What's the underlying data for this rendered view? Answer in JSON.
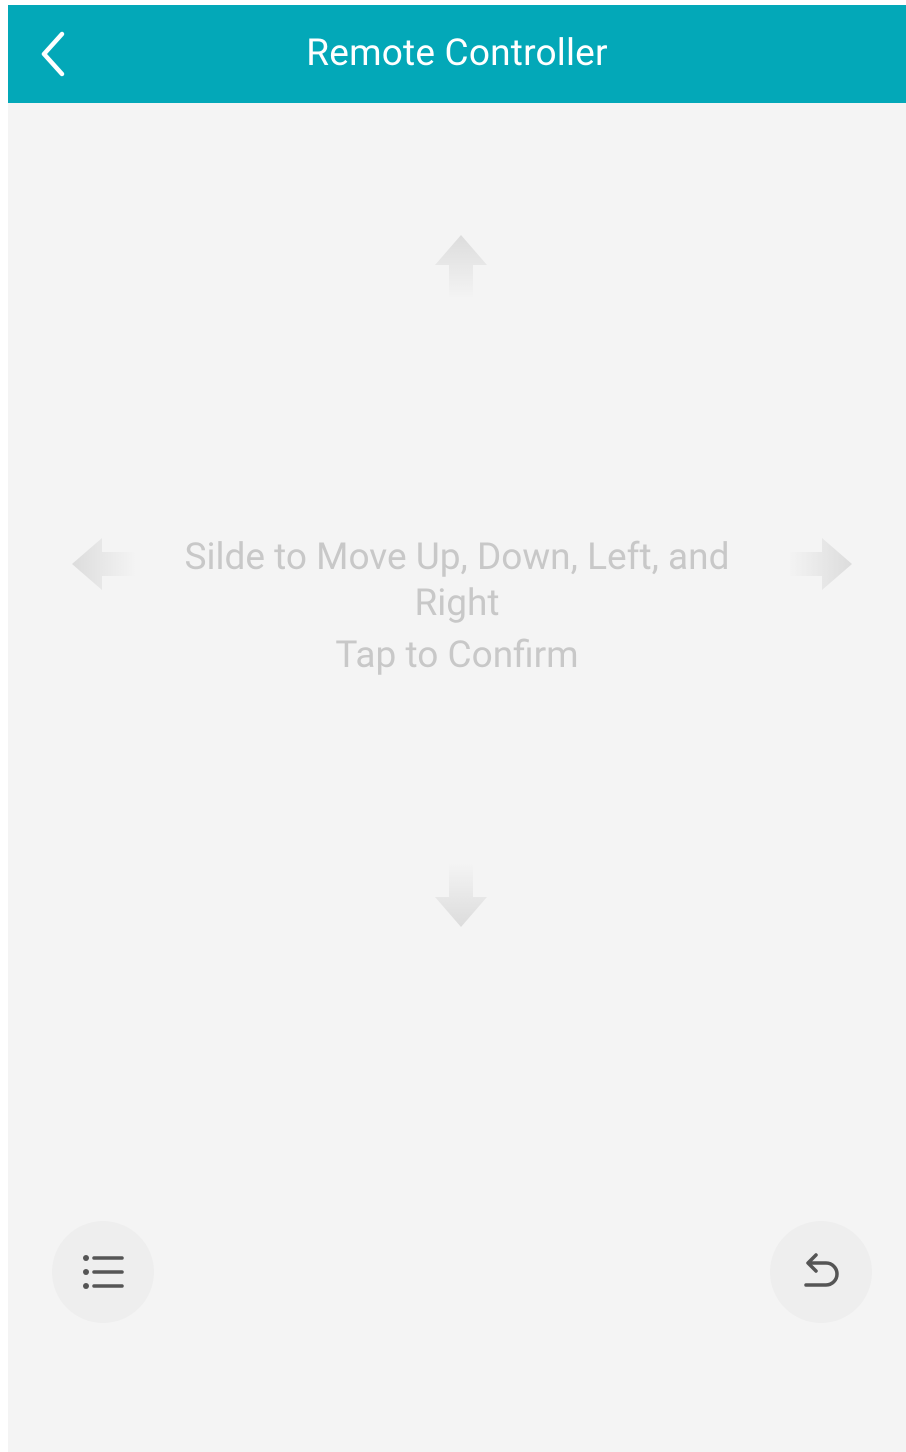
{
  "header": {
    "title": "Remote Controller",
    "back_icon": "chevron-left-icon"
  },
  "pad": {
    "hint_line1": "Silde to Move Up, Down, Left, and Right",
    "hint_line2": "Tap to Confirm",
    "arrows": [
      "arrow-up-icon",
      "arrow-down-icon",
      "arrow-left-icon",
      "arrow-right-icon"
    ]
  },
  "bottom": {
    "menu_icon": "list-icon",
    "return_icon": "return-icon"
  },
  "colors": {
    "accent": "#03a8b8",
    "background": "#f4f4f4",
    "hint_text": "#c8c8c8",
    "button_bg": "#eeeeee"
  }
}
